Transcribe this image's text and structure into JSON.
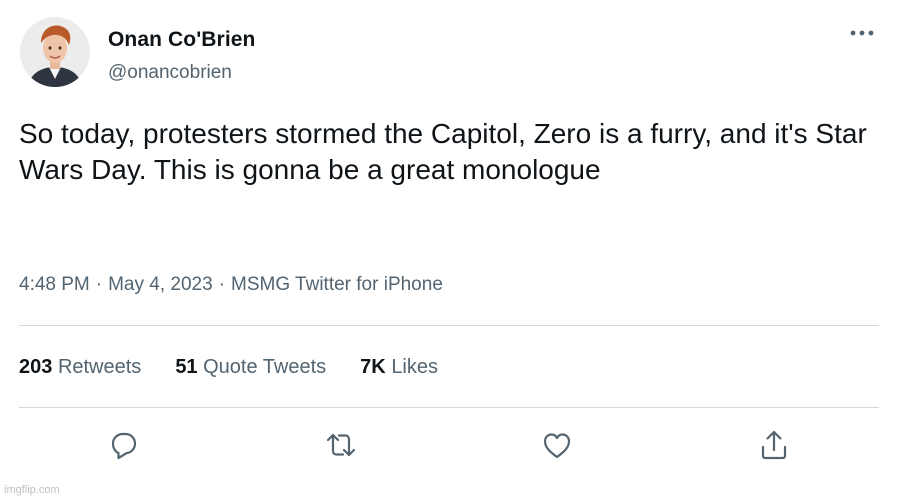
{
  "author": {
    "display_name": "Onan Co'Brien",
    "handle": "@onancobrien",
    "avatar_icon": "profile-photo"
  },
  "tweet": {
    "text": "So today, protesters stormed the Capitol, Zero is a furry, and it's Star Wars Day. This is gonna be a great monologue",
    "time": "4:48 PM",
    "date": "May 4, 2023",
    "separator": "·",
    "source": "MSMG Twitter for iPhone"
  },
  "stats": {
    "retweets_count": "203",
    "retweets_label": "Retweets",
    "quotes_count": "51",
    "quotes_label": "Quote Tweets",
    "likes_count": "7K",
    "likes_label": "Likes"
  },
  "actions": {
    "reply_icon": "reply-icon",
    "retweet_icon": "retweet-icon",
    "like_icon": "heart-icon",
    "share_icon": "share-icon",
    "more_icon": "more-icon"
  },
  "colors": {
    "text_primary": "#0f1419",
    "text_secondary": "#536471",
    "divider": "#cfd9de"
  },
  "watermark": "imgflip.com"
}
